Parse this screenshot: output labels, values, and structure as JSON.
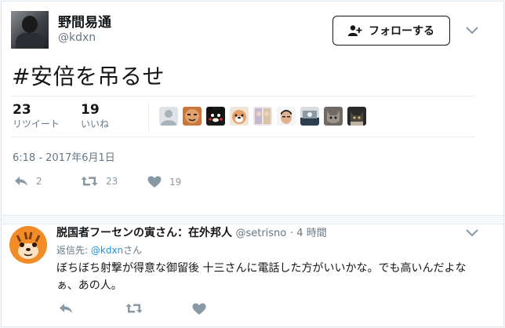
{
  "colors": {
    "link": "#1b95e0",
    "muted": "#657786",
    "text": "#14171a"
  },
  "tweet": {
    "author_name": "野間易通",
    "author_handle": "@kdxn",
    "follow_label": "フォローする",
    "text": "#安倍を吊るせ",
    "retweets_count": "23",
    "retweets_label": "リツイート",
    "likes_count": "19",
    "likes_label": "いいね",
    "timestamp": "6:18 - 2017年6月1日",
    "actions": {
      "reply_count": "2",
      "retweet_count": "23",
      "like_count": "19"
    }
  },
  "reply": {
    "author_name": "脱国者フーセンの寅さん：在外邦人",
    "author_handle": "@setrisno",
    "separator": "·",
    "time": "4 時間",
    "reply_to_label": "返信先:",
    "reply_to_handle": "@kdxn",
    "reply_to_suffix": "さん",
    "text": "ぼちぼち射撃が得意な御留後 十三さんに電話した方がいいかな。でも高いんだよなぁ、あの人。"
  }
}
